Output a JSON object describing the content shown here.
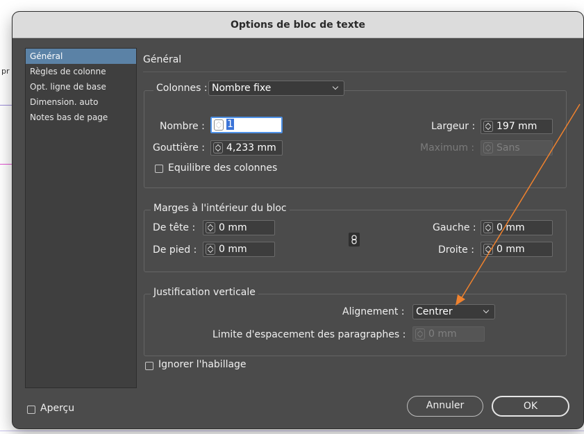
{
  "dialog": {
    "title": "Options de bloc de texte"
  },
  "background": {
    "partial_text": "pr"
  },
  "sidebar": {
    "items": [
      {
        "label": "Général",
        "selected": true
      },
      {
        "label": "Règles de colonne"
      },
      {
        "label": "Opt. ligne de base"
      },
      {
        "label": "Dimension. auto"
      },
      {
        "label": "Notes bas de page"
      }
    ]
  },
  "main": {
    "section_title": "Général",
    "columns": {
      "label": "Colonnes :",
      "select_value": "Nombre fixe",
      "nombre_label": "Nombre :",
      "nombre_value": "1",
      "largeur_label": "Largeur :",
      "largeur_value": "197 mm",
      "gouttiere_label": "Gouttière :",
      "gouttiere_value": "4,233 mm",
      "maximum_label": "Maximum :",
      "maximum_value": "Sans",
      "balance_label": "Equilibre des colonnes"
    },
    "inset": {
      "legend": "Marges à l'intérieur du bloc",
      "tete_label": "De tête :",
      "tete_value": "0 mm",
      "pied_label": "De pied :",
      "pied_value": "0 mm",
      "gauche_label": "Gauche :",
      "gauche_value": "0 mm",
      "droite_label": "Droite :",
      "droite_value": "0 mm"
    },
    "vertical": {
      "legend": "Justification verticale",
      "alignment_label": "Alignement :",
      "alignment_value": "Centrer",
      "spacing_label": "Limite d'espacement des paragraphes :",
      "spacing_value": "0 mm"
    },
    "ignore_wrap_label": "Ignorer l'habillage"
  },
  "footer": {
    "preview_label": "Aperçu",
    "cancel_label": "Annuler",
    "ok_label": "OK"
  },
  "colors": {
    "dialog_bg": "#4b4b4b",
    "selection": "#5b82a6",
    "focus": "#4e91e6",
    "annotation_arrow": "#f0822e"
  }
}
